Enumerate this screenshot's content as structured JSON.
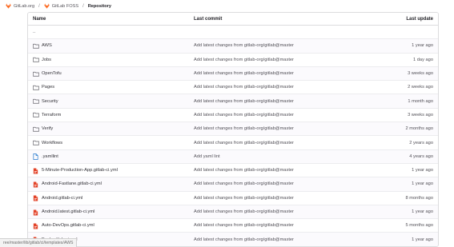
{
  "breadcrumb": {
    "items": [
      "GitLab.org",
      "GitLab FOSS",
      "Repository"
    ],
    "separator": "/"
  },
  "table": {
    "headers": {
      "name": "Name",
      "last_commit": "Last commit",
      "last_update": "Last update"
    },
    "rows": [
      {
        "type": "parent",
        "icon": "",
        "name": "..",
        "commit": "",
        "date": ""
      },
      {
        "type": "folder",
        "icon": "folder-icon",
        "name": "AWS",
        "commit": "Add latest changes from gitlab-org/gitlab@master",
        "date": "1 year ago"
      },
      {
        "type": "folder",
        "icon": "folder-icon",
        "name": "Jobs",
        "commit": "Add latest changes from gitlab-org/gitlab@master",
        "date": "1 day ago"
      },
      {
        "type": "folder",
        "icon": "folder-icon",
        "name": "OpenTofu",
        "commit": "Add latest changes from gitlab-org/gitlab@master",
        "date": "3 weeks ago"
      },
      {
        "type": "folder",
        "icon": "folder-icon",
        "name": "Pages",
        "commit": "Add latest changes from gitlab-org/gitlab@master",
        "date": "2 weeks ago"
      },
      {
        "type": "folder",
        "icon": "folder-icon",
        "name": "Security",
        "commit": "Add latest changes from gitlab-org/gitlab@master",
        "date": "1 month ago"
      },
      {
        "type": "folder",
        "icon": "folder-icon",
        "name": "Terraform",
        "commit": "Add latest changes from gitlab-org/gitlab@master",
        "date": "3 weeks ago"
      },
      {
        "type": "folder",
        "icon": "folder-icon",
        "name": "Verify",
        "commit": "Add latest changes from gitlab-org/gitlab@master",
        "date": "2 months ago"
      },
      {
        "type": "folder",
        "icon": "folder-icon",
        "name": "Workflows",
        "commit": "Add latest changes from gitlab-org/gitlab@master",
        "date": "2 years ago"
      },
      {
        "type": "file",
        "icon": "file-icon",
        "name": ".yamllint",
        "commit": "Add yaml lint",
        "date": "4 years ago"
      },
      {
        "type": "file",
        "icon": "gitlab-ci-file-icon",
        "name": "5-Minute-Production-App.gitlab-ci.yml",
        "commit": "Add latest changes from gitlab-org/gitlab@master",
        "date": "1 year ago"
      },
      {
        "type": "file",
        "icon": "gitlab-ci-file-icon",
        "name": "Android-Fastlane.gitlab-ci.yml",
        "commit": "Add latest changes from gitlab-org/gitlab@master",
        "date": "1 year ago"
      },
      {
        "type": "file",
        "icon": "gitlab-ci-file-icon",
        "name": "Android.gitlab-ci.yml",
        "commit": "Add latest changes from gitlab-org/gitlab@master",
        "date": "8 months ago"
      },
      {
        "type": "file",
        "icon": "gitlab-ci-file-icon",
        "name": "Android.latest.gitlab-ci.yml",
        "commit": "Add latest changes from gitlab-org/gitlab@master",
        "date": "1 year ago"
      },
      {
        "type": "file",
        "icon": "gitlab-ci-file-icon",
        "name": "Auto-DevOps.gitlab-ci.yml",
        "commit": "Add latest changes from gitlab-org/gitlab@master",
        "date": "5 months ago"
      },
      {
        "type": "file",
        "icon": "gitlab-ci-file-icon",
        "name": "Bash.gitlab-ci.yml",
        "commit": "Add latest changes from gitlab-org/gitlab@master",
        "date": "1 year ago"
      }
    ]
  },
  "status_bar": {
    "url": "ree/master/lib/gitlab/ci/templates/AWS"
  },
  "colors": {
    "folder": "#626168",
    "gitlab_ci": "#e24329",
    "file": "#1f75cb",
    "tanuki": "#fc6d26"
  }
}
